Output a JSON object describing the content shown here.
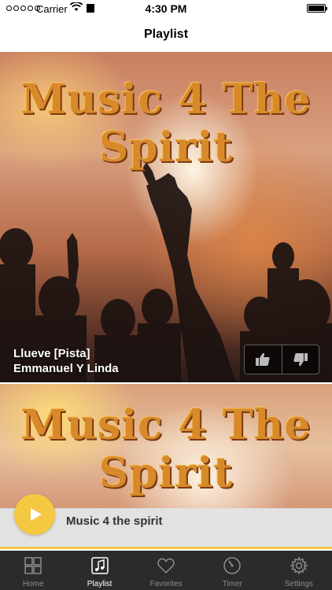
{
  "status_bar": {
    "carrier": "Carrier",
    "time": "4:30 PM"
  },
  "nav": {
    "title": "Playlist"
  },
  "playlist": [
    {
      "artwork_text": "Music 4 The Spirit",
      "title": "Llueve [Pista]",
      "artist": "Emmanuel Y Linda"
    },
    {
      "artwork_text": "Music 4 The Spirit"
    }
  ],
  "now_playing": {
    "title": "Music 4 the spirit"
  },
  "tabs": [
    {
      "label": "Home",
      "icon": "grid-icon"
    },
    {
      "label": "Playlist",
      "icon": "music-note-icon",
      "active": true
    },
    {
      "label": "Favorites",
      "icon": "heart-icon"
    },
    {
      "label": "Timer",
      "icon": "timer-icon"
    },
    {
      "label": "Settings",
      "icon": "gear-icon"
    }
  ],
  "colors": {
    "accent": "#f5c842",
    "tab_bar": "#2b2b2b",
    "now_playing_bg": "#e2e2e2"
  }
}
